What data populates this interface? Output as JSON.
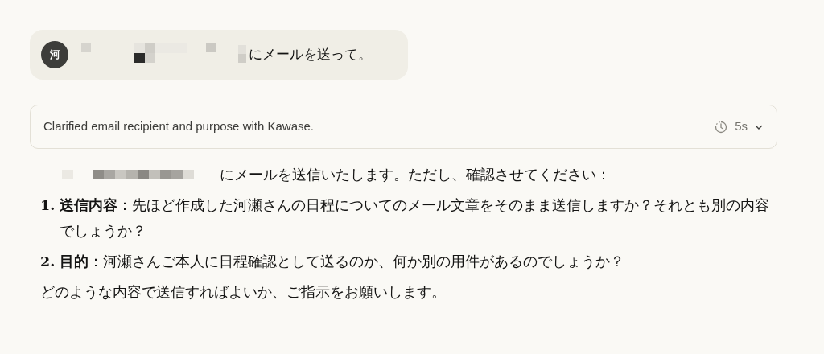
{
  "user_message": {
    "avatar": "河",
    "text": "にメールを送って。"
  },
  "thinking": {
    "summary": "Clarified email recipient and purpose with Kawase.",
    "duration": "5s",
    "expanded": false
  },
  "response": {
    "intro": "にメールを送信いたします。ただし、確認させてください：",
    "items": [
      {
        "number": "1.",
        "text": "**送信内容**：先ほど作成した河瀬さんの日程についてのメール文章をそのまま送信しますか？それとも別の内容でしょうか？"
      },
      {
        "number": "2.",
        "text": "**目的**：河瀬さんご本人に日程確認として送るのか、何か別の用件があるのでしょうか？"
      }
    ],
    "closing": "どのような内容で送信すればよいか、ご指示をお願いします。"
  }
}
